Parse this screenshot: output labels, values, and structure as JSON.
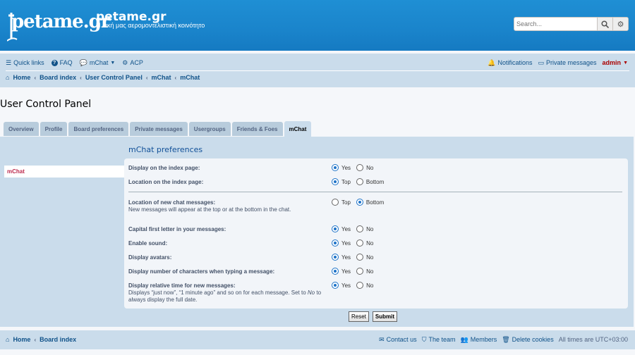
{
  "header": {
    "logo_text": "petame.gr",
    "site_title": "petame.gr",
    "site_description": "Η δική μας αερομοντελιστική κοινότητο",
    "search": {
      "placeholder": "Search...",
      "search_icon": "magnifier",
      "advanced_icon": "gear"
    }
  },
  "nav": {
    "left": [
      {
        "icon": "bars",
        "label": "Quick links",
        "dropdown": false
      },
      {
        "icon": "question-circle",
        "label": "FAQ",
        "dropdown": false
      },
      {
        "icon": "comments",
        "label": "mChat",
        "dropdown": true
      },
      {
        "icon": "cogs",
        "label": "ACP",
        "dropdown": false
      }
    ],
    "right": {
      "notifications": "Notifications",
      "private_messages": "Private messages",
      "username": "admin"
    },
    "breadcrumbs": [
      "Home",
      "Board index",
      "User Control Panel",
      "mChat",
      "mChat"
    ]
  },
  "page_title": "User Control Panel",
  "tabs": [
    {
      "label": "Overview",
      "active": false
    },
    {
      "label": "Profile",
      "active": false
    },
    {
      "label": "Board preferences",
      "active": false
    },
    {
      "label": "Private messages",
      "active": false
    },
    {
      "label": "Usergroups",
      "active": false
    },
    {
      "label": "Friends & Foes",
      "active": false
    },
    {
      "label": "mChat",
      "active": true
    }
  ],
  "sidebar": {
    "items": [
      {
        "label": "mChat",
        "active": true
      }
    ]
  },
  "prefs": {
    "heading": "mChat preferences",
    "rows": [
      {
        "label": "Display on the index page:",
        "desc": "",
        "options": [
          "Yes",
          "No"
        ],
        "selected": "Yes"
      },
      {
        "label": "Location on the index page:",
        "desc": "",
        "options": [
          "Top",
          "Bottom"
        ],
        "selected": "Top"
      },
      {
        "label": "Location of new chat messages:",
        "desc": "New messages will appear at the top or at the bottom in the chat.",
        "options": [
          "Top",
          "Bottom"
        ],
        "selected": "Bottom"
      },
      {
        "label": "Capital first letter in your messages:",
        "desc": "",
        "options": [
          "Yes",
          "No"
        ],
        "selected": "Yes"
      },
      {
        "label": "Enable sound:",
        "desc": "",
        "options": [
          "Yes",
          "No"
        ],
        "selected": "Yes"
      },
      {
        "label": "Display avatars:",
        "desc": "",
        "options": [
          "Yes",
          "No"
        ],
        "selected": "Yes"
      },
      {
        "label": "Display number of characters when typing a message:",
        "desc": "",
        "options": [
          "Yes",
          "No"
        ],
        "selected": "Yes"
      },
      {
        "label": "Display relative time for new messages:",
        "desc_parts": [
          "Displays “just now”, “1 minute ago” and so on for each message. Set to ",
          "No",
          " to always display the full date."
        ],
        "options": [
          "Yes",
          "No"
        ],
        "selected": "Yes"
      }
    ],
    "reset_label": "Reset",
    "submit_label": "Submit"
  },
  "footer": {
    "breadcrumbs": [
      "Home",
      "Board index"
    ],
    "links": [
      "Contact us",
      "The team",
      "Members",
      "Delete cookies"
    ],
    "timezone": "All times are UTC+03:00"
  },
  "colors": {
    "header_bg": "#1a84cb",
    "nav_bg": "#cadceb",
    "link": "#105289",
    "accent_red": "#bc2a4d"
  }
}
